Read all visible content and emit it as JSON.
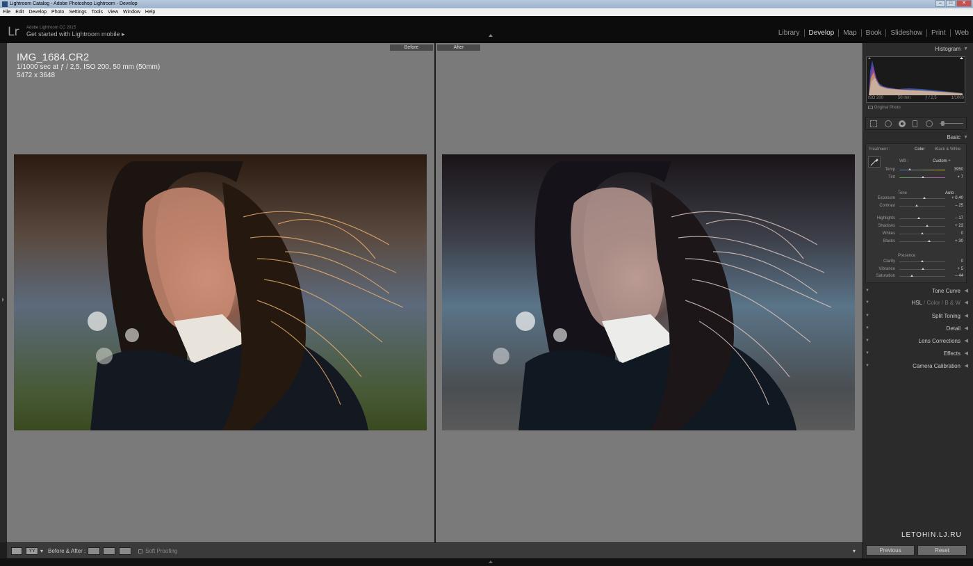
{
  "window": {
    "title": "Lightroom Catalog - Adobe Photoshop Lightroom - Develop"
  },
  "menu": [
    "File",
    "Edit",
    "Develop",
    "Photo",
    "Settings",
    "Tools",
    "View",
    "Window",
    "Help"
  ],
  "identity": {
    "logo": "Lr",
    "version": "Adobe Lightroom CC 2015",
    "mobile": "Get started with Lightroom mobile ▸"
  },
  "modules": [
    "Library",
    "Develop",
    "Map",
    "Book",
    "Slideshow",
    "Print",
    "Web"
  ],
  "active_module": "Develop",
  "photo_info": {
    "filename": "IMG_1684.CR2",
    "exposure": "1/1000 sec at ƒ / 2,5, ISO 200, 50 mm (50mm)",
    "dimensions": "5472 x 3648"
  },
  "compare": {
    "before_label": "Before",
    "after_label": "After"
  },
  "toolbar": {
    "before_after_label": "Before & After :",
    "soft_proofing": "Soft Proofing"
  },
  "histogram": {
    "title": "Histogram",
    "iso": "ISO 200",
    "focal": "50 mm",
    "aperture": "ƒ / 2,5",
    "shutter": "1/1000",
    "original_photo": "Original Photo"
  },
  "basic": {
    "title": "Basic",
    "treatment_label": "Treatment :",
    "treatment_color": "Color",
    "treatment_bw": "Black & White",
    "wb_label": "WB :",
    "wb_value": "Custom ÷",
    "tone_label": "Tone",
    "auto_label": "Auto",
    "presence_label": "Presence",
    "sliders": [
      {
        "label": "Temp",
        "value": "3950",
        "pos": 0.22
      },
      {
        "label": "Tint",
        "value": "+ 7",
        "pos": 0.52
      },
      {
        "label": "Exposure",
        "value": "+ 0,40",
        "pos": 0.55
      },
      {
        "label": "Contrast",
        "value": "– 25",
        "pos": 0.38
      },
      {
        "label": "Highlights",
        "value": "– 17",
        "pos": 0.42
      },
      {
        "label": "Shadows",
        "value": "+ 23",
        "pos": 0.6
      },
      {
        "label": "Whites",
        "value": "0",
        "pos": 0.5
      },
      {
        "label": "Blacks",
        "value": "+ 30",
        "pos": 0.65
      },
      {
        "label": "Clarity",
        "value": "0",
        "pos": 0.5
      },
      {
        "label": "Vibrance",
        "value": "+ 5",
        "pos": 0.52
      },
      {
        "label": "Saturation",
        "value": "– 44",
        "pos": 0.28
      }
    ]
  },
  "panels": {
    "tone_curve": "Tone Curve",
    "hsl": "HSL",
    "color": "Color",
    "bw": "B & W",
    "hsl_sep": "/",
    "split_toning": "Split Toning",
    "detail": "Detail",
    "lens_corrections": "Lens Corrections",
    "effects": "Effects",
    "camera_calibration": "Camera Calibration"
  },
  "nav": {
    "previous": "Previous",
    "reset": "Reset"
  },
  "watermark": "LETOHIN.LJ.RU"
}
